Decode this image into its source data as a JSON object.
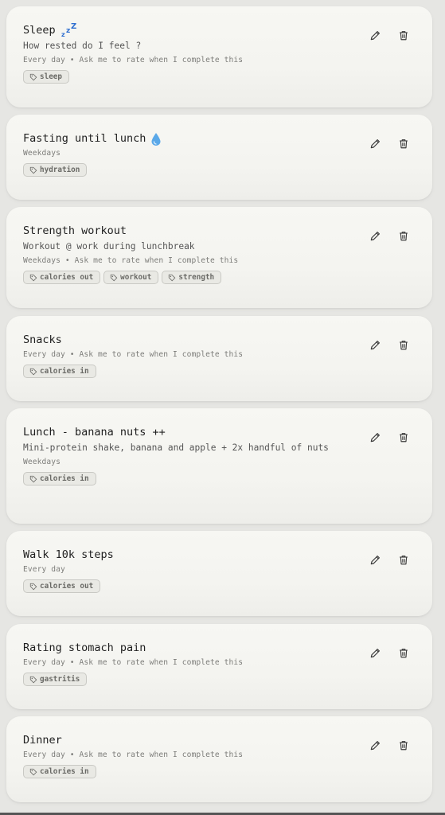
{
  "habits": [
    {
      "title": "Sleep",
      "emoji": "sleep-zzz",
      "description": "How rested do I feel ?",
      "meta": "Every day • Ask me to rate when I complete this",
      "tags": [
        "sleep"
      ]
    },
    {
      "title": "Fasting until lunch",
      "emoji": "water-drop",
      "description": "",
      "meta": "Weekdays",
      "tags": [
        "hydration"
      ]
    },
    {
      "title": "Strength workout",
      "emoji": "",
      "description": "Workout @ work during lunchbreak",
      "meta": "Weekdays • Ask me to rate when I complete this",
      "tags": [
        "calories out",
        "workout",
        "strength"
      ]
    },
    {
      "title": "Snacks",
      "emoji": "",
      "description": "",
      "meta": "Every day • Ask me to rate when I complete this",
      "tags": [
        "calories in"
      ]
    },
    {
      "title": "Lunch - banana nuts ++",
      "emoji": "",
      "description": "Mini-protein shake, banana and apple + 2x handful of nuts",
      "meta": "Weekdays",
      "tags": [
        "calories in"
      ]
    },
    {
      "title": "Walk 10k steps",
      "emoji": "",
      "description": "",
      "meta": "Every day",
      "tags": [
        "calories out"
      ]
    },
    {
      "title": "Rating stomach pain",
      "emoji": "",
      "description": "",
      "meta": "Every day • Ask me to rate when I complete this",
      "tags": [
        "gastritis"
      ]
    },
    {
      "title": "Dinner",
      "emoji": "",
      "description": "",
      "meta": "Every day • Ask me to rate when I complete this",
      "tags": [
        "calories in"
      ]
    }
  ],
  "icons": {
    "edit": "pencil-icon",
    "delete": "trash-icon",
    "tag": "tag-icon"
  },
  "colors": {
    "card_bg": "#f5f5f1",
    "page_bg": "#e6e6e3",
    "tag_bg": "#e9e9e4",
    "emoji_blue": "#3a7bd5"
  }
}
